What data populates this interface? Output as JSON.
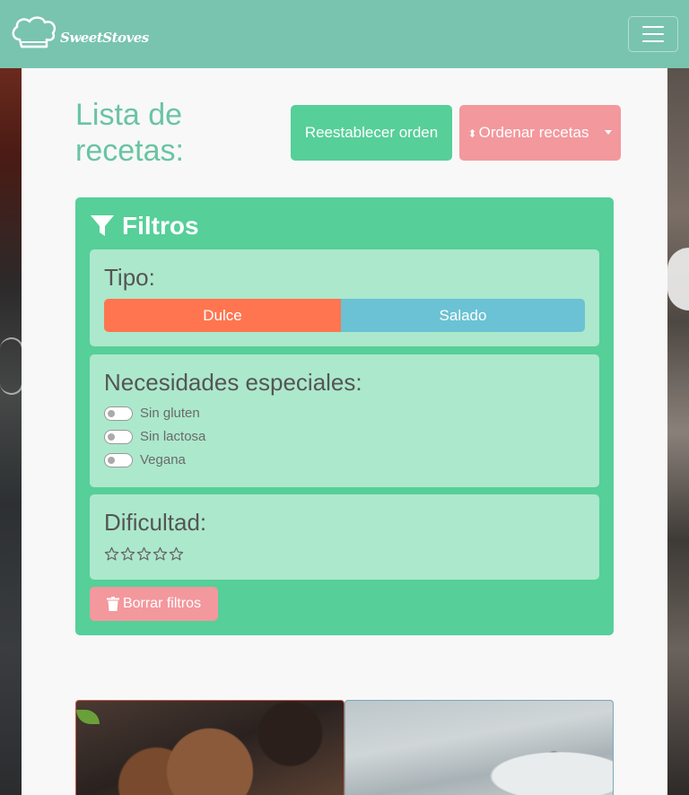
{
  "navbar": {
    "brand_name": "SweetStoves",
    "toggler_icon": "hamburger-icon"
  },
  "header": {
    "title": "Lista de recetas:",
    "reset_label": "Reestablecer orden",
    "order_label": "Ordenar recetas",
    "order_icon": "sort-icon"
  },
  "filters": {
    "title": "Filtros",
    "icon": "filter-icon",
    "tipo": {
      "title": "Tipo:",
      "options": [
        "Dulce",
        "Salado"
      ]
    },
    "necesidades": {
      "title": "Necesidades especiales:",
      "options": [
        "Sin gluten",
        "Sin lactosa",
        "Vegana"
      ]
    },
    "dificultad": {
      "title": "Dificultad:",
      "stars_selected": 0,
      "stars_total": 5
    },
    "clear_label": "Borrar filtros",
    "clear_icon": "trash-icon"
  },
  "colors": {
    "navbar": "#79c4ae",
    "primary_green": "#56cf99",
    "light_green": "#ace8cc",
    "pink": "#f3989d",
    "orange": "#ff7550",
    "blue": "#6ac2d4",
    "title_green": "#6ac4a4"
  }
}
